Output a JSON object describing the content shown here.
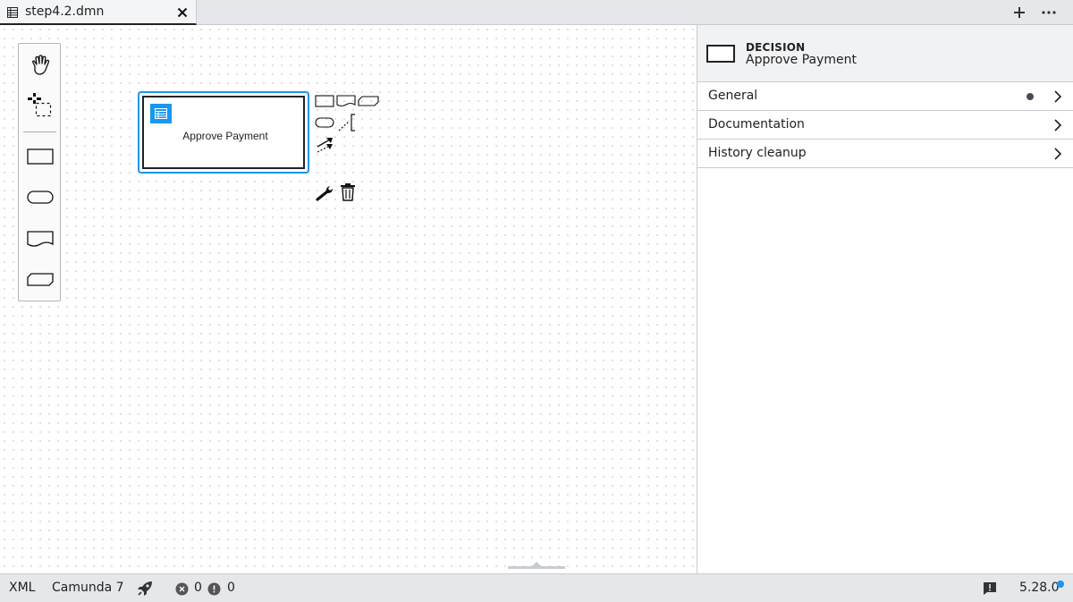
{
  "tabbar": {
    "tabs": [
      {
        "label": "step4.2.dmn",
        "active": true
      }
    ]
  },
  "palette": {
    "tools": [
      "hand-tool",
      "lasso-tool",
      "decision",
      "input-data",
      "knowledge-source",
      "business-knowledge-model"
    ]
  },
  "canvas": {
    "decision": {
      "label": "Approve Payment"
    }
  },
  "panel": {
    "header": {
      "type": "DECISION",
      "name": "Approve Payment"
    },
    "groups": [
      {
        "label": "General",
        "has_data": true
      },
      {
        "label": "Documentation",
        "has_data": false
      },
      {
        "label": "History cleanup",
        "has_data": false
      }
    ]
  },
  "statusbar": {
    "xml": "XML",
    "engine": "Camunda 7",
    "errors": "0",
    "warnings": "0",
    "version": "5.28.0"
  },
  "colors": {
    "accent": "#1a97f0",
    "chrome": "#e5e7eb"
  }
}
